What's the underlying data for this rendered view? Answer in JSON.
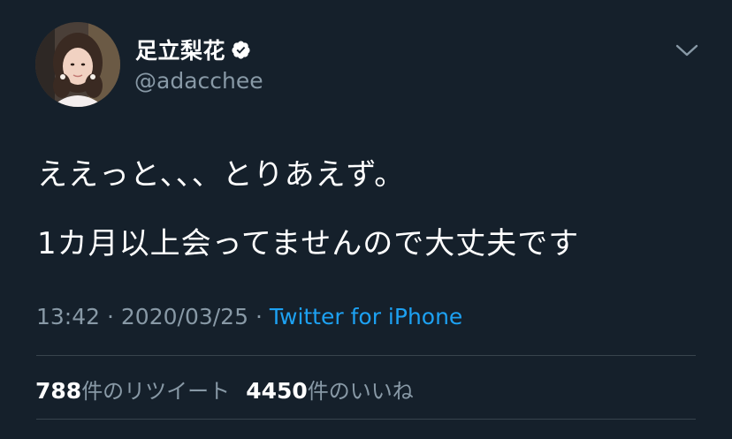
{
  "user": {
    "display_name": "足立梨花",
    "handle": "@adacchee",
    "verified": true,
    "avatar_icon": "profile-photo"
  },
  "tweet": {
    "lines": [
      "ええっと、、、とりあえず。",
      "1カ月以上会ってませんので大丈夫です"
    ],
    "time": "13:42",
    "separator": "·",
    "date": "2020/03/25",
    "source": "Twitter for iPhone"
  },
  "stats": {
    "retweets_count": "788",
    "retweets_label": "件のリツイート",
    "likes_count": "4450",
    "likes_label": "件のいいね"
  },
  "colors": {
    "background": "#15202b",
    "text": "#ffffff",
    "muted": "#8899a6",
    "link": "#1da1f2",
    "divider": "#38444d"
  }
}
